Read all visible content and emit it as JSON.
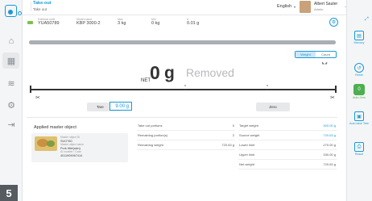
{
  "header": {
    "title": "Take-out",
    "subtitle": "Take out",
    "language": "English",
    "user_name": "Albert Sauter",
    "user_role": "Admin",
    "minimize": "–",
    "close": "×"
  },
  "info": {
    "status_color": "#77c34b",
    "fields": [
      {
        "label": "External code",
        "value": "YUA50789"
      },
      {
        "label": "Model name",
        "value": "KBP 3000-2"
      },
      {
        "label": "Max",
        "value": "3 kg"
      },
      {
        "label": "Min",
        "value": "0 kg"
      },
      {
        "label": "d",
        "value": "0.01 g"
      }
    ]
  },
  "progress": {
    "fill_percent": 100
  },
  "mode_toggle": {
    "options": [
      "Weight",
      "Count"
    ],
    "selected": "Weight"
  },
  "stability": "◣◢",
  "display": {
    "net_label": "NET",
    "value": "0",
    "unit": "g",
    "status": "Removed"
  },
  "scale": {
    "left_icon": "scissors-icon",
    "right_icon": "scissors-icon"
  },
  "tare": {
    "label": "Tare",
    "value": "9.00 g"
  },
  "zero": {
    "label": "Zero"
  },
  "master": {
    "title": "Applied master object",
    "object_id_label": "Master object ID",
    "object_id": "SUG760",
    "object_name_label": "Master object name",
    "object_name": "Pork fillet(skin)",
    "id_number_label": "ID number / Code",
    "id_number": "4011909067414"
  },
  "takeout": {
    "rows": [
      {
        "label": "Take out portions",
        "value": "0"
      },
      {
        "label": "Remaining portion(s)",
        "value": "2"
      },
      {
        "label": "Remaining weight",
        "value": "720.63 g"
      }
    ]
  },
  "targets": {
    "rows": [
      {
        "label": "Target weight",
        "value": "300.00 g",
        "blue": true
      },
      {
        "label": "Source weight",
        "value": "720.63 g",
        "blue": true
      },
      {
        "label": "Lower limit",
        "value": "270.00 g",
        "blue": false
      },
      {
        "label": "Upper limit",
        "value": "330.00 g",
        "blue": false
      },
      {
        "label": "Net weight",
        "value": "720.63 g",
        "blue": false
      }
    ]
  },
  "right_rail": [
    {
      "label": "Memory",
      "icon": "memory-icon"
    },
    {
      "label": "Reset",
      "icon": "reset-icon"
    },
    {
      "label": "Auto Zero",
      "icon": "auto-zero-icon"
    },
    {
      "label": "Auto save Tare",
      "icon": "save-tare-icon"
    },
    {
      "label": "Result",
      "icon": "printer-icon"
    }
  ],
  "page_badge": "5"
}
